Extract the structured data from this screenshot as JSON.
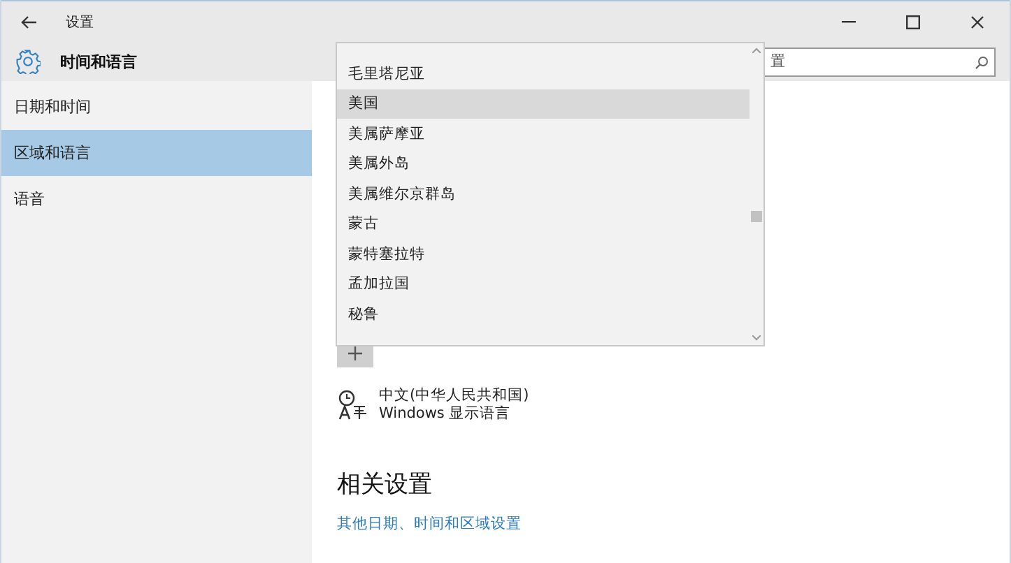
{
  "window": {
    "title": "设置"
  },
  "header": {
    "title": "时间和语言"
  },
  "sidebar": {
    "items": [
      {
        "label": "日期和时间",
        "selected": false
      },
      {
        "label": "区域和语言",
        "selected": true
      },
      {
        "label": "语音",
        "selected": false
      }
    ]
  },
  "search": {
    "placeholder": "置"
  },
  "country_dropdown": {
    "items": [
      {
        "label": "毛里塔尼亚",
        "selected": false
      },
      {
        "label": "美国",
        "selected": true
      },
      {
        "label": "美属萨摩亚",
        "selected": false
      },
      {
        "label": "美属外岛",
        "selected": false
      },
      {
        "label": "美属维尔京群岛",
        "selected": false
      },
      {
        "label": "蒙古",
        "selected": false
      },
      {
        "label": "蒙特塞拉特",
        "selected": false
      },
      {
        "label": "孟加拉国",
        "selected": false
      },
      {
        "label": "秘鲁",
        "selected": false
      }
    ]
  },
  "languages": [
    {
      "name": "中文(中华人民共和国)",
      "detail": "Windows 显示语言"
    }
  ],
  "related_settings": {
    "heading": "相关设置",
    "links": [
      "其他日期、时间和区域设置"
    ]
  }
}
